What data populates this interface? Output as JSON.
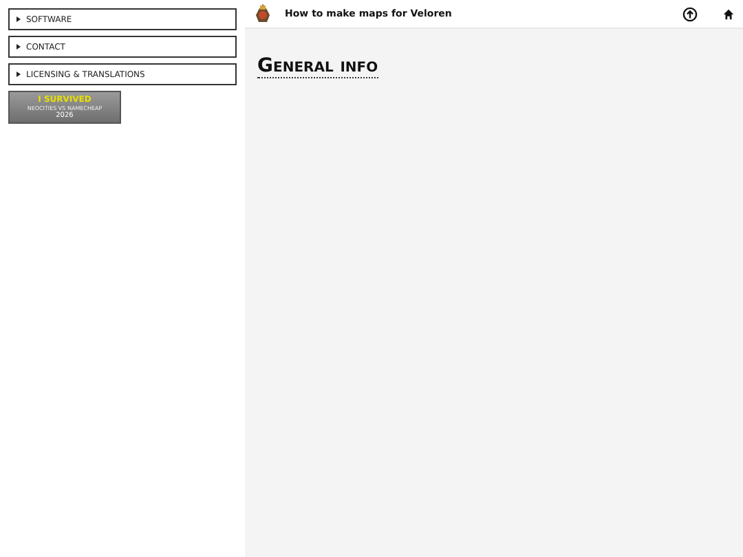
{
  "sidebar": {
    "items": [
      {
        "label": "SOFTWARE",
        "expanded": false
      },
      {
        "label": "CONTACT",
        "expanded": false
      },
      {
        "label": "LICENSING & TRANSLATIONS",
        "expanded": false
      }
    ],
    "badge": {
      "lines": [
        "I SURVIVED",
        "NEOCITIES VS NAMECHEAP",
        "2026"
      ]
    }
  },
  "header": {
    "title": "How to make maps for Veloren"
  },
  "content": {
    "heading": "General info"
  }
}
